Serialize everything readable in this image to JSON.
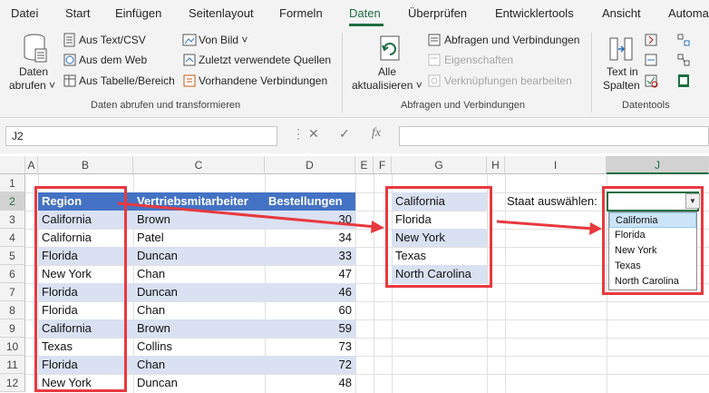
{
  "tabs": [
    "Datei",
    "Start",
    "Einfügen",
    "Seitenlayout",
    "Formeln",
    "Daten",
    "Überprüfen",
    "Entwicklertools",
    "Ansicht",
    "Automa"
  ],
  "active_tab": "Daten",
  "ribbon": {
    "get_data": {
      "line1": "Daten",
      "line2": "abrufen ˅"
    },
    "from_text": "Aus Text/CSV",
    "from_web": "Aus dem Web",
    "from_table": "Aus Tabelle/Bereich",
    "from_picture": "Von Bild ˅",
    "recent_sources": "Zuletzt verwendete Quellen",
    "existing_connections": "Vorhandene Verbindungen",
    "group1_label": "Daten abrufen und transformieren",
    "refresh_all": {
      "line1": "Alle",
      "line2": "aktualisieren ˅"
    },
    "queries_connections": "Abfragen und Verbindungen",
    "properties": "Eigenschaften",
    "edit_links": "Verknüpfungen bearbeiten",
    "group2_label": "Abfragen und Verbindungen",
    "text_to_columns": {
      "line1": "Text in",
      "line2": "Spalten"
    },
    "group3_label": "Datentools"
  },
  "formula_bar": {
    "name_box": "J2",
    "cancel": "✕",
    "enter": "✓",
    "fx": "fx",
    "value": ""
  },
  "columns": [
    "A",
    "B",
    "C",
    "D",
    "E",
    "F",
    "G",
    "H",
    "I",
    "J"
  ],
  "rows": [
    "1",
    "2",
    "3",
    "4",
    "5",
    "6",
    "7",
    "8",
    "9",
    "10",
    "11",
    "12"
  ],
  "table": {
    "headers": [
      "Region",
      "Vertriebsmitarbeiter",
      "Bestellungen"
    ],
    "rows": [
      [
        "California",
        "Brown",
        "30"
      ],
      [
        "California",
        "Patel",
        "34"
      ],
      [
        "Florida",
        "Duncan",
        "33"
      ],
      [
        "New York",
        "Chan",
        "47"
      ],
      [
        "Florida",
        "Duncan",
        "46"
      ],
      [
        "Florida",
        "Chan",
        "60"
      ],
      [
        "California",
        "Brown",
        "59"
      ],
      [
        "Texas",
        "Collins",
        "73"
      ],
      [
        "Florida",
        "Chan",
        "72"
      ],
      [
        "New York",
        "Duncan",
        "48"
      ]
    ]
  },
  "states_list": [
    "California",
    "Florida",
    "New York",
    "Texas",
    "North Carolina"
  ],
  "select_label": "Staat auswählen:",
  "dropdown_options": [
    "California",
    "Florida",
    "New York",
    "Texas",
    "North Carolina"
  ],
  "colors": {
    "accent": "#1e6e41",
    "table_header": "#4472c4",
    "band": "#d9e1f2",
    "highlight": "#e8393f"
  }
}
